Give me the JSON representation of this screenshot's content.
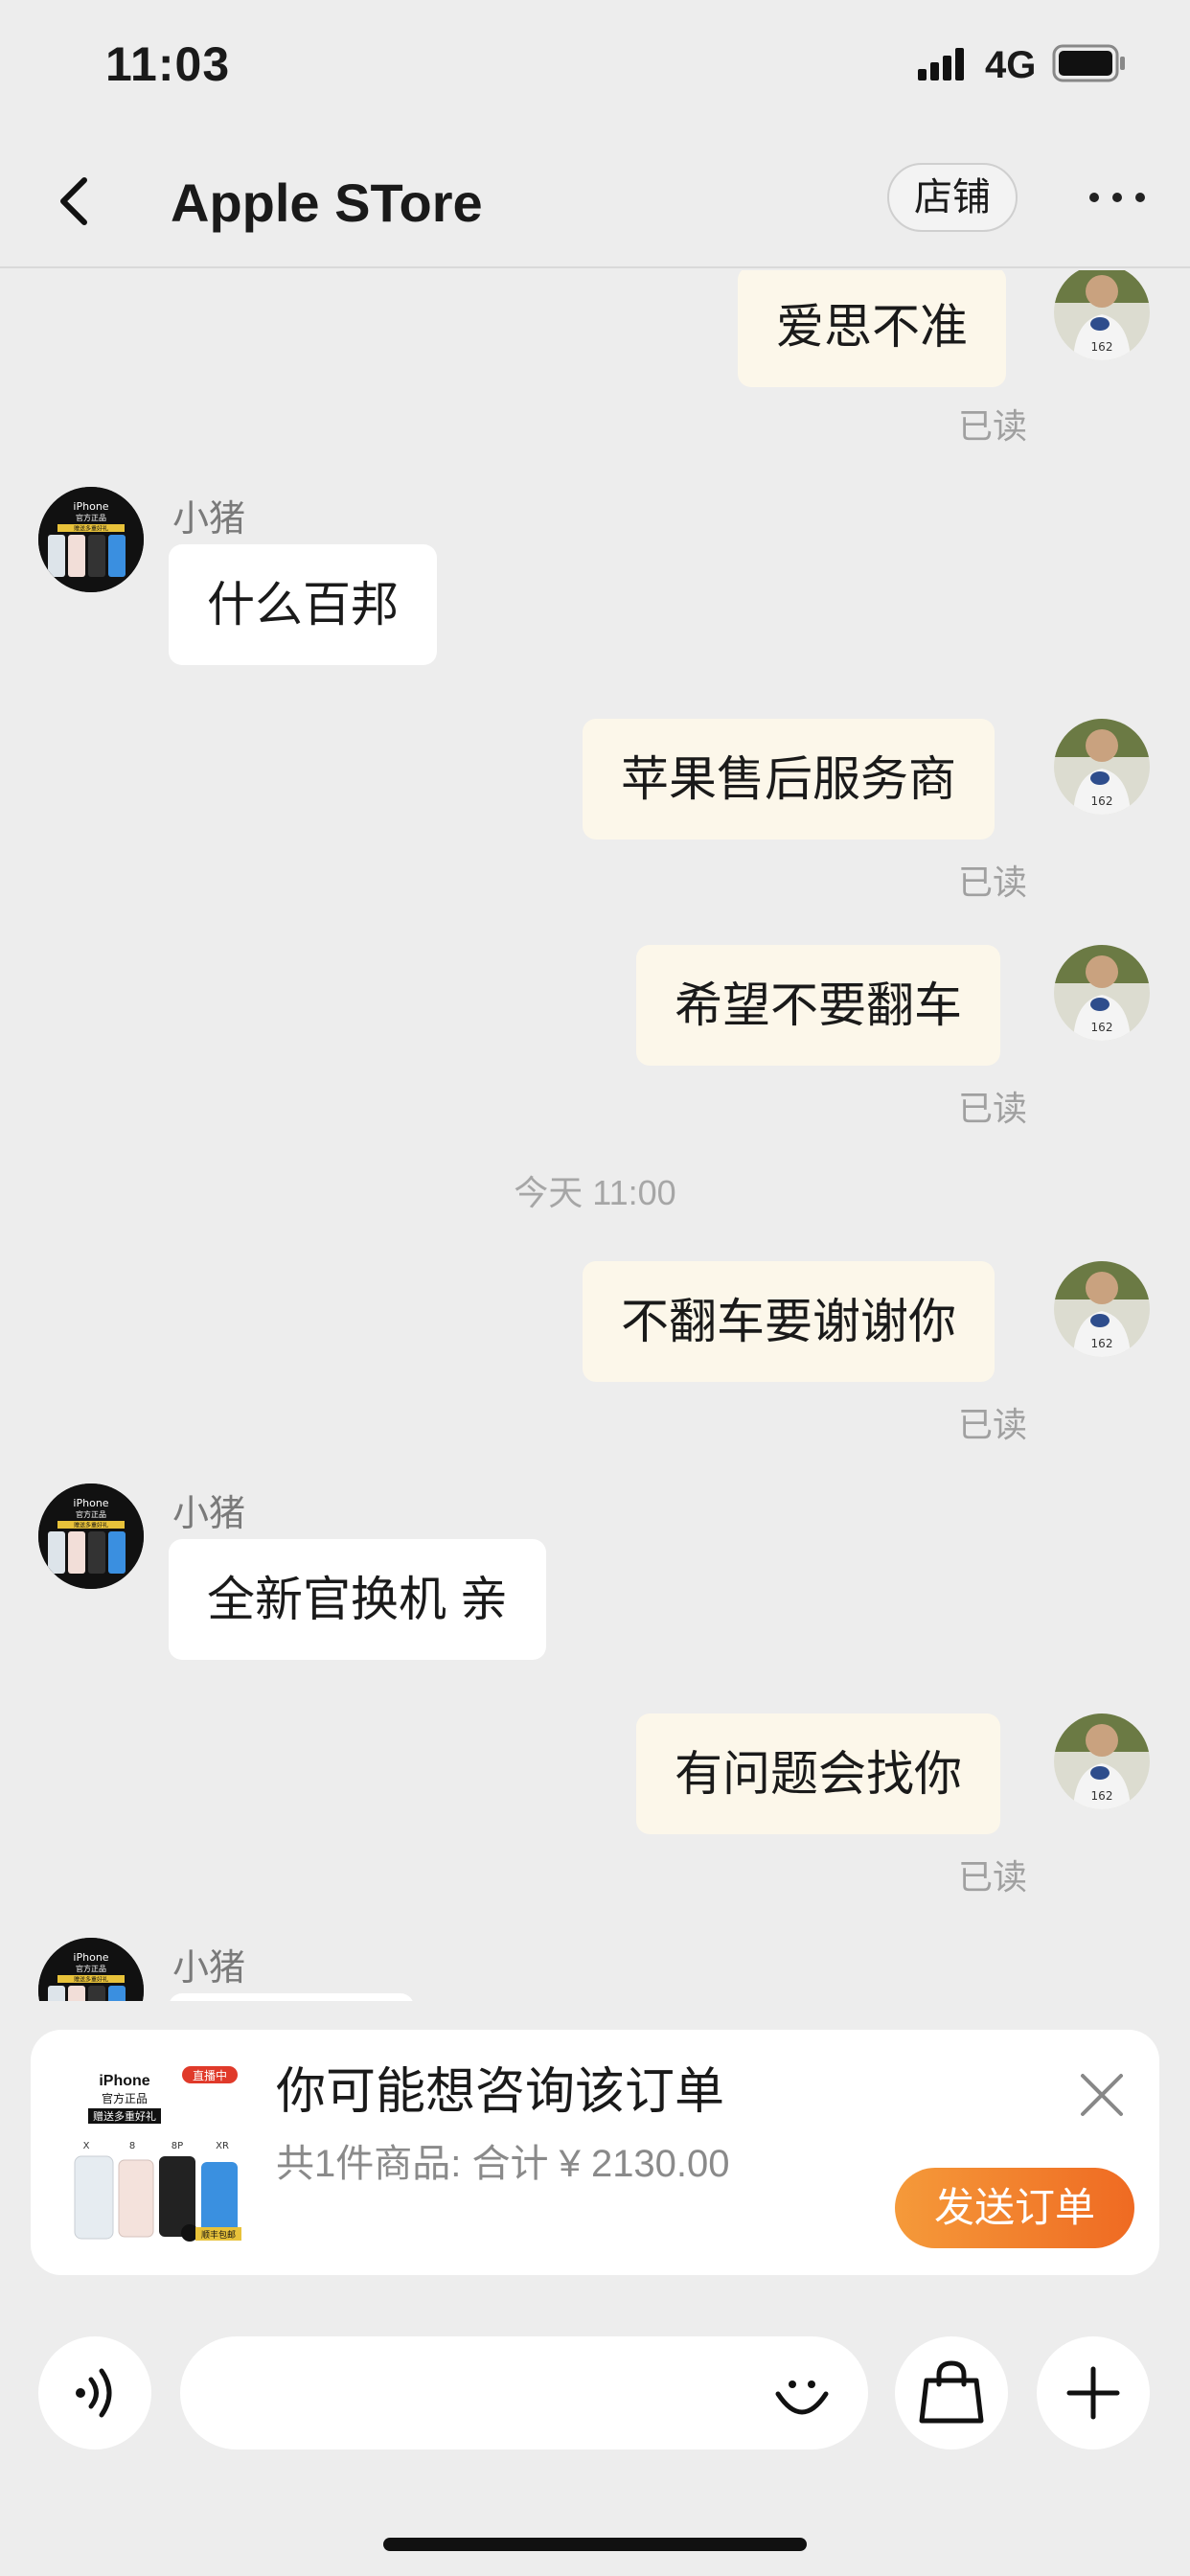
{
  "status_bar": {
    "time": "11:03",
    "network": "4G"
  },
  "header": {
    "title": "Apple STore",
    "shop_label": "店铺"
  },
  "messages": [
    {
      "direction": "out",
      "text": "爱思不准",
      "status": "已读"
    },
    {
      "direction": "in",
      "sender": "小猪",
      "text": "什么百邦"
    },
    {
      "direction": "out",
      "text": "苹果售后服务商",
      "status": "已读"
    },
    {
      "direction": "out",
      "text": "希望不要翻车",
      "status": "已读"
    },
    {
      "direction": "out",
      "text": "不翻车要谢谢你",
      "status": "已读"
    },
    {
      "direction": "in",
      "sender": "小猪",
      "text": "全新官换机 亲"
    },
    {
      "direction": "out",
      "text": "有问题会找你",
      "status": "已读"
    },
    {
      "direction": "in",
      "sender": "小猪",
      "text": ""
    }
  ],
  "timestamp": "今天 11:00",
  "order_card": {
    "title": "你可能想咨询该订单",
    "summary": "共1件商品:  合计  ¥ 2130.00",
    "send_label": "发送订单",
    "product_image": {
      "brand": "iPhone",
      "badge": "直播中",
      "tagline": "官方正品",
      "promo": "赠送多重好礼",
      "models": [
        "X",
        "8",
        "8P",
        "XR"
      ],
      "shipping": "顺丰包邮"
    }
  },
  "avatar_in": {
    "brand": "iPhone",
    "tagline": "官方正品",
    "promo": "赠送多重好礼"
  },
  "avatar_out": {
    "number": "162"
  },
  "colors": {
    "bubble_out": "#fcf7ea",
    "bubble_in": "#ffffff",
    "send_button": "#ef6a22",
    "background": "#ededed"
  }
}
